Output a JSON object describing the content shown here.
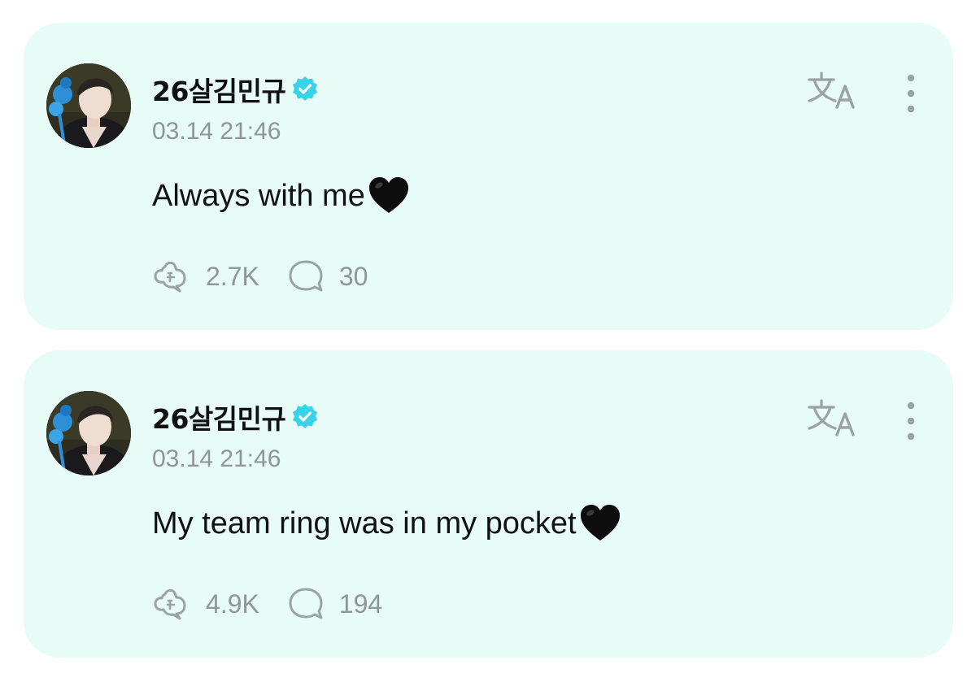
{
  "colors": {
    "card_background": "#e7fbf7",
    "verified_badge": "#38d3e6",
    "secondary_text": "#8e9696",
    "icon": "#9aa3a3"
  },
  "posts": [
    {
      "author": "26살김민규",
      "verified": true,
      "timestamp": "03.14 21:46",
      "text": "Always with me",
      "emoji": "black-heart",
      "reactions": "2.7K",
      "comments": "30",
      "icons": {
        "translate": "translate-icon",
        "more": "more-options-icon",
        "reaction": "reaction-icon",
        "comment": "comment-icon"
      }
    },
    {
      "author": "26살김민규",
      "verified": true,
      "timestamp": "03.14 21:46",
      "text": "My team ring was in my pocket",
      "emoji": "black-heart",
      "reactions": "4.9K",
      "comments": "194",
      "icons": {
        "translate": "translate-icon",
        "more": "more-options-icon",
        "reaction": "reaction-icon",
        "comment": "comment-icon"
      }
    }
  ]
}
